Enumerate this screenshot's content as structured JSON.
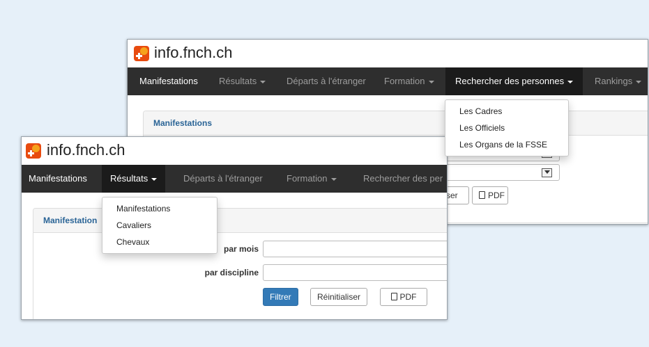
{
  "back_window": {
    "brand": "info.fnch.ch",
    "nav": [
      "Manifestations",
      "Résultats",
      "Départs à l'étranger",
      "Formation",
      "Rechercher des personnes",
      "Rankings"
    ],
    "panel_title": "Manifestations",
    "dropdown": [
      "Les Cadres",
      "Les Officiels",
      "Les Organs de la FSSE"
    ],
    "reset_partial": "ser",
    "pdf_label": "PDF"
  },
  "front_window": {
    "brand": "info.fnch.ch",
    "nav": [
      "Manifestations",
      "Résultats",
      "Départs à l'étranger",
      "Formation",
      "Rechercher des per"
    ],
    "panel_title": "Manifestation",
    "dropdown": [
      "Manifestations",
      "Cavaliers",
      "Chevaux"
    ],
    "form": {
      "month_label": "par mois",
      "discipline_label": "par discipline",
      "month_value": "",
      "discipline_value": ""
    },
    "buttons": {
      "filter": "Filtrer",
      "reset": "Réinitialiser",
      "pdf": "PDF"
    }
  },
  "colors": {
    "background": "#e6f0f9",
    "navbar": "#2e2e2e",
    "primary": "#337ab7",
    "link": "#2a6496"
  },
  "icons": [
    "fnch-logo-icon",
    "caret-down-icon",
    "select-arrow-icon",
    "document-icon"
  ]
}
